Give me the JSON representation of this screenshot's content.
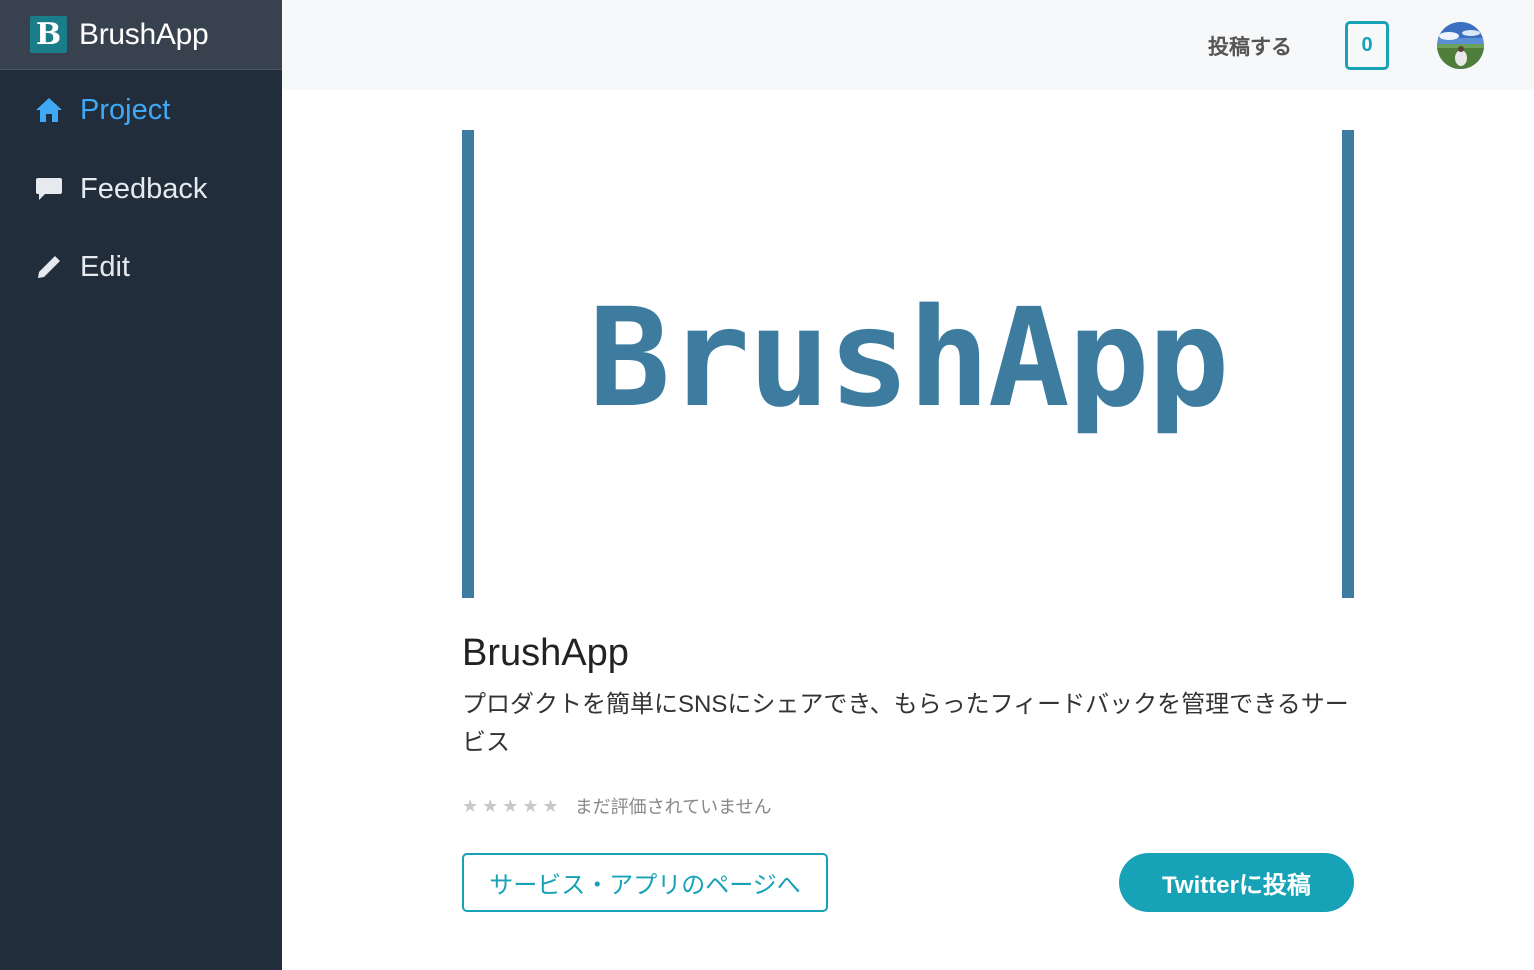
{
  "brand": {
    "logo_letter": "B",
    "name": "BrushApp"
  },
  "sidebar": {
    "items": [
      {
        "label": "Project",
        "icon": "home-icon",
        "active": true
      },
      {
        "label": "Feedback",
        "icon": "comment-icon",
        "active": false
      },
      {
        "label": "Edit",
        "icon": "pencil-icon",
        "active": false
      }
    ]
  },
  "topbar": {
    "post_label": "投稿する",
    "notification_count": "0"
  },
  "hero": {
    "title": "BrushApp"
  },
  "project": {
    "title": "BrushApp",
    "description": "プロダクトを簡単にSNSにシェアでき、もらったフィードバックを管理できるサービス",
    "stars": "★★★★★",
    "rating_text": "まだ評価されていません"
  },
  "actions": {
    "service_page_label": "サービス・アプリのページへ",
    "twitter_label": "Twitterに投稿"
  },
  "colors": {
    "sidebar_bg": "#212d3a",
    "accent": "#17a2b8",
    "active": "#3fa9f5",
    "hero": "#3d7c9e"
  }
}
